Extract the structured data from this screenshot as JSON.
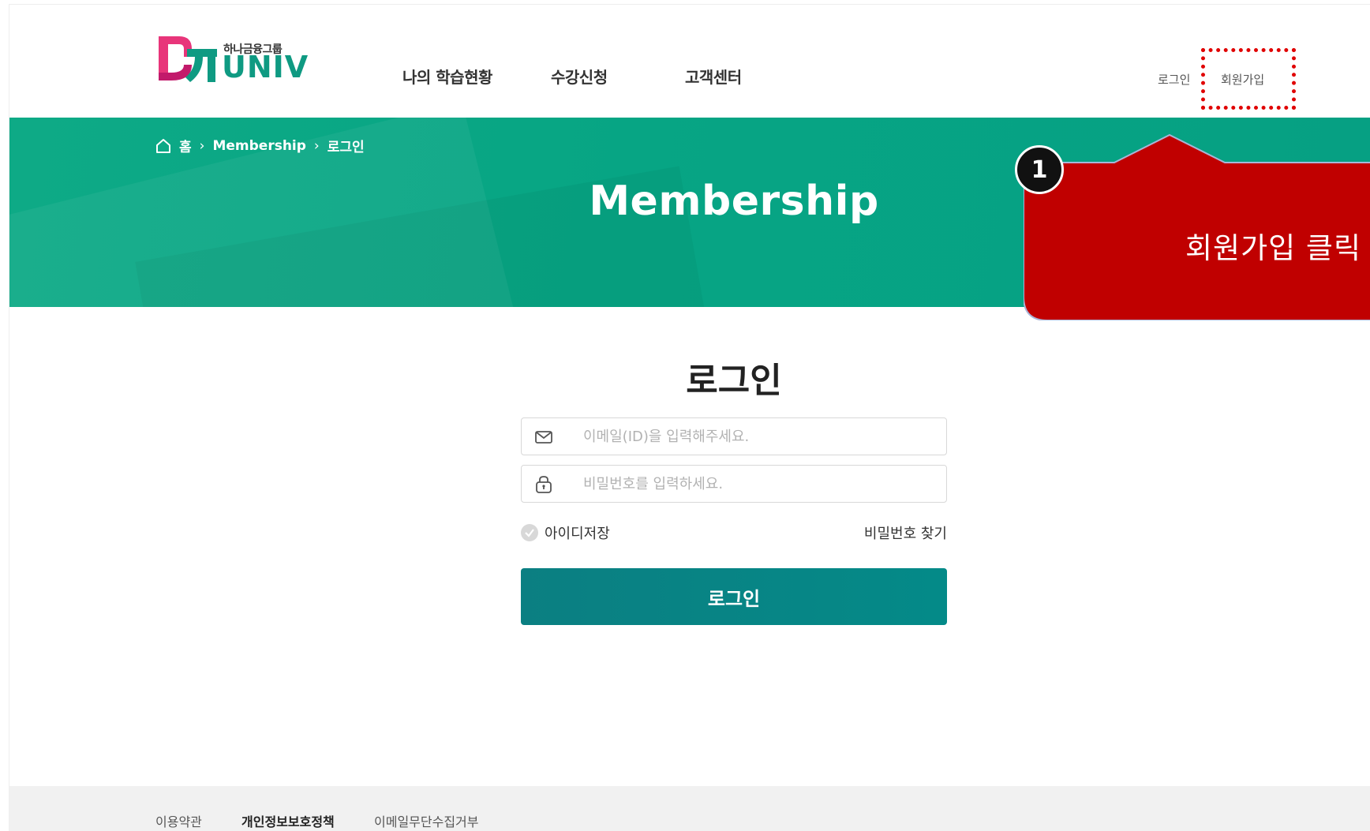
{
  "header": {
    "logo_group_text": "하나금융그룹",
    "logo_univ_text": "UNIV",
    "nav": [
      "나의 학습현황",
      "수강신청",
      "고객센터"
    ],
    "util": {
      "login": "로그인",
      "signup": "회원가입"
    }
  },
  "banner": {
    "breadcrumb": [
      "홈",
      "Membership",
      "로그인"
    ],
    "title": "Membership"
  },
  "callout": {
    "step": "1",
    "text": "회원가입 클릭"
  },
  "login": {
    "title": "로그인",
    "email_placeholder": "이메일(ID)을 입력해주세요.",
    "password_placeholder": "비밀번호를 입력하세요.",
    "remember_label": "아이디저장",
    "find_password": "비밀번호 찾기",
    "submit": "로그인"
  },
  "footer": {
    "links": [
      "이용약관",
      "개인정보보호정책",
      "이메일무단수집거부"
    ]
  },
  "colors": {
    "brand_green": "#07a584",
    "button_teal": "#048a88",
    "callout_red": "#c00000",
    "highlight_red": "#e00000"
  }
}
